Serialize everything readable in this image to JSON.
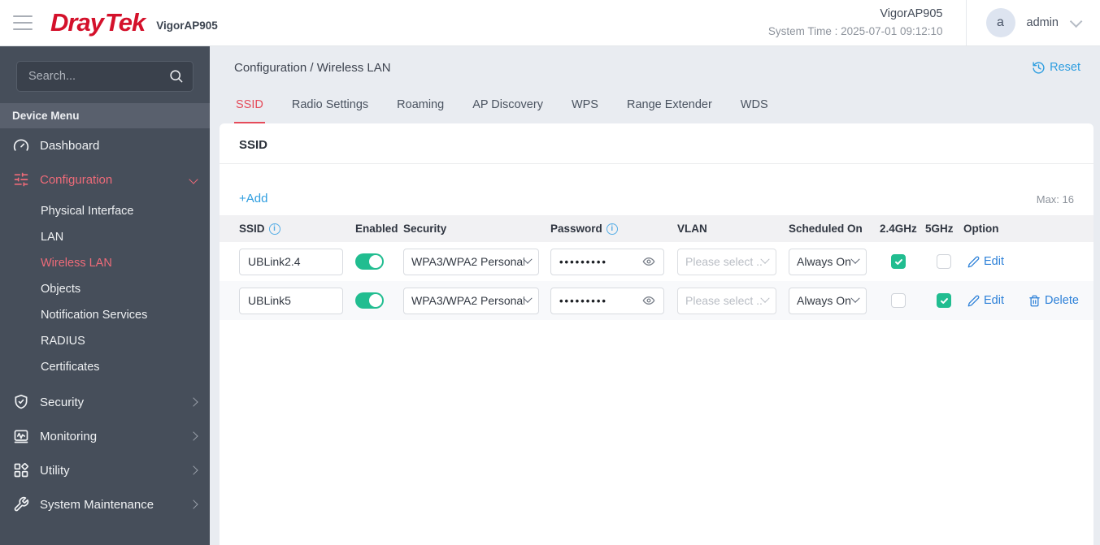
{
  "header": {
    "brand_part1": "Dray",
    "brand_part2": "Tek",
    "model": "VigorAP905",
    "device_name": "VigorAP905",
    "system_time": "System Time : 2025-07-01 09:12:10",
    "user": {
      "initial": "a",
      "name": "admin"
    }
  },
  "sidebar": {
    "search_placeholder": "Search...",
    "section_label": "Device Menu",
    "dashboard_label": "Dashboard",
    "configuration_label": "Configuration",
    "config_children": {
      "0": "Physical Interface",
      "1": "LAN",
      "2": "Wireless LAN",
      "3": "Objects",
      "4": "Notification Services",
      "5": "RADIUS",
      "6": "Certificates"
    },
    "security_label": "Security",
    "monitoring_label": "Monitoring",
    "utility_label": "Utility",
    "system_maintenance_label": "System Maintenance"
  },
  "main": {
    "breadcrumb": "Configuration / Wireless LAN",
    "reset_label": "Reset",
    "tabs": {
      "0": "SSID",
      "1": "Radio Settings",
      "2": "Roaming",
      "3": "AP Discovery",
      "4": "WPS",
      "5": "Range Extender",
      "6": "WDS"
    },
    "active_tab": "SSID",
    "panel": {
      "title": "SSID",
      "add_label": "+Add",
      "max_label": "Max: 16",
      "columns": {
        "ssid": "SSID",
        "enabled": "Enabled",
        "security": "Security",
        "password": "Password",
        "vlan": "VLAN",
        "scheduled_on": "Scheduled On",
        "band24": "2.4GHz",
        "band5": "5GHz",
        "option": "Option"
      },
      "info_glyph": "i",
      "rows": {
        "0": {
          "ssid": "UBLink2.4",
          "enabled": true,
          "security": "WPA3/WPA2 Personal",
          "password_masked": "•••••••••",
          "vlan": "Please select ...",
          "scheduled_on": "Always On",
          "band_2_4": true,
          "band_5": false,
          "edit_label": "Edit"
        },
        "1": {
          "ssid": "UBLink5",
          "enabled": true,
          "security": "WPA3/WPA2 Personal",
          "password_masked": "•••••••••",
          "vlan": "Please select ...",
          "scheduled_on": "Always On",
          "band_2_4": false,
          "band_5": true,
          "edit_label": "Edit",
          "delete_label": "Delete"
        }
      }
    }
  },
  "colors": {
    "brand_red": "#d4112b",
    "sidebar_bg": "#464e5a",
    "sidebar_active": "#ee6b79",
    "accent_blue": "#2f9ee0",
    "link_blue": "#2c80d8",
    "toggle_green": "#21bd90",
    "tab_active_red": "#e54b5a"
  }
}
